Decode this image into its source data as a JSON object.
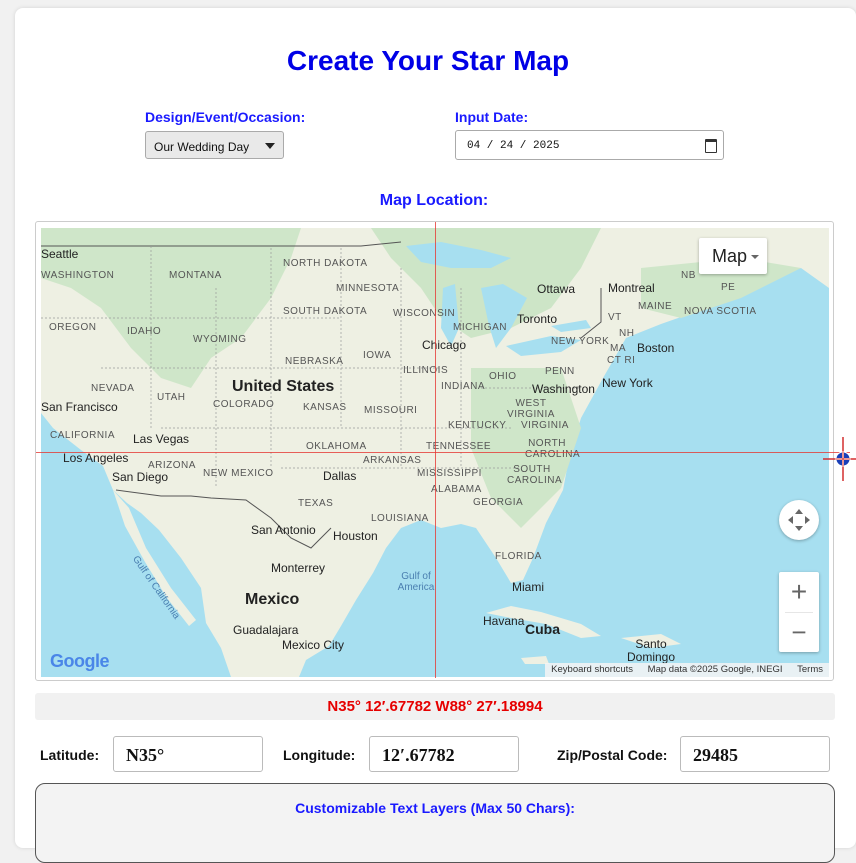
{
  "page": {
    "title": "Create Your Star Map",
    "design_label": "Design/Event/Occasion:",
    "design_value": "Our Wedding Day",
    "date_label": "Input Date:",
    "date_value": "04 / 24 / 2025",
    "map_location_label": "Map Location:"
  },
  "map": {
    "map_type_button": "Map",
    "footer": {
      "shortcuts": "Keyboard shortcuts",
      "data": "Map data ©2025 Google, INEGI",
      "terms": "Terms"
    },
    "logo": "Google",
    "zoom_in": "+",
    "zoom_out": "−",
    "country_labels": [
      "United States",
      "Mexico"
    ],
    "state_labels": [
      "NORTH DAKOTA",
      "MONTANA",
      "WASHINGTON",
      "MINNESOTA",
      "SOUTH DAKOTA",
      "WISCONSIN",
      "MICHIGAN",
      "OREGON",
      "IDAHO",
      "WYOMING",
      "NEBRASKA",
      "IOWA",
      "ILLINOIS",
      "INDIANA",
      "OHIO",
      "PENN",
      "NEVADA",
      "UTAH",
      "COLORADO",
      "KANSAS",
      "MISSOURI",
      "WEST VIRGINIA",
      "VIRGINIA",
      "KENTUCKY",
      "CALIFORNIA",
      "OKLAHOMA",
      "TENNESSEE",
      "NORTH CAROLINA",
      "ARIZONA",
      "NEW MEXICO",
      "ARKANSAS",
      "MISSISSIPPI",
      "SOUTH CAROLINA",
      "ALABAMA",
      "GEORGIA",
      "TEXAS",
      "LOUISIANA",
      "FLORIDA",
      "NEW YORK",
      "VT",
      "NH",
      "MA",
      "CT RI",
      "MAINE",
      "NOVA SCOTIA",
      "NB",
      "PE"
    ],
    "cities": [
      "Seattle",
      "Ottawa",
      "Montreal",
      "Toronto",
      "Boston",
      "Chicago",
      "New York",
      "Washington",
      "San Francisco",
      "Las Vegas",
      "Los Angeles",
      "San Diego",
      "Dallas",
      "Houston",
      "San Antonio",
      "Monterrey",
      "Miami",
      "Havana",
      "Cuba",
      "Guadalajara",
      "Mexico City",
      "Santo Domingo"
    ],
    "water_labels": [
      "Gulf of America",
      "Gulf of California"
    ]
  },
  "coordinates": {
    "display": "N35° 12′.67782 W88° 27′.18994",
    "latitude_label": "Latitude:",
    "latitude_value": "N35°",
    "longitude_label": "Longitude:",
    "longitude_value": "12′.67782",
    "zip_label": "Zip/Postal Code:",
    "zip_value": "29485"
  },
  "text_layers": {
    "heading": "Customizable Text Layers (Max 50 Chars):"
  },
  "colors": {
    "title": "#0000e6",
    "label": "#1a1aff",
    "coords": "#e60000",
    "crosshair": "#e53935"
  }
}
